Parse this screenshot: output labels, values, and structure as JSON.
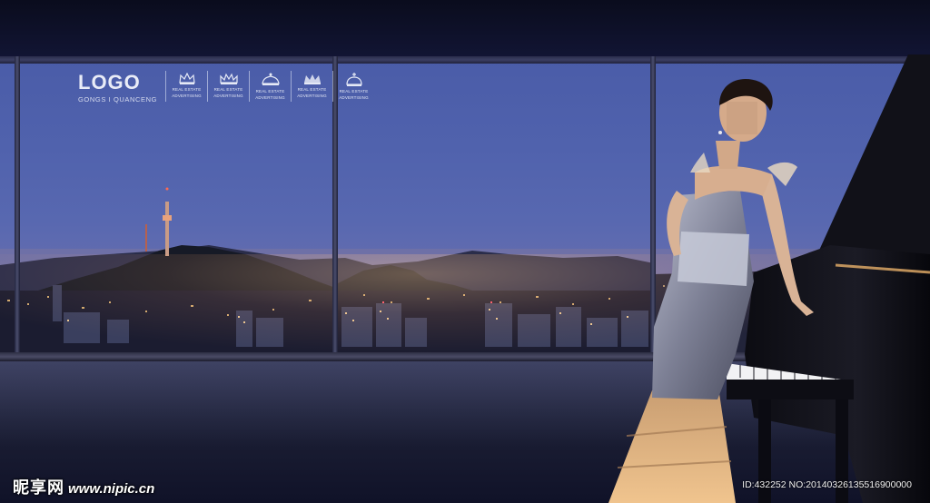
{
  "logo": {
    "word": "LOGO",
    "sub": "GONGS I QUANCENG"
  },
  "badges": [
    {
      "icon": "crown-icon",
      "line1": "REAL ESTATE",
      "line2": "ADVERTISING"
    },
    {
      "icon": "crown-icon",
      "line1": "REAL ESTATE",
      "line2": "ADVERTISING"
    },
    {
      "icon": "crown-icon",
      "line1": "REAL ESTATE",
      "line2": "ADVERTISING"
    },
    {
      "icon": "crown-icon",
      "line1": "REAL ESTATE",
      "line2": "ADVERTISING"
    },
    {
      "icon": "crown-icon",
      "line1": "REAL ESTATE",
      "line2": "ADVERTISING"
    }
  ],
  "watermark": {
    "brand": "昵享网",
    "url": "www.nipic.cn",
    "id_text": "ID:432252 NO:20140326135516900000"
  },
  "colors": {
    "sky": "#5062ad",
    "frame": "#23253f",
    "accent_gold": "#e8b06a"
  }
}
